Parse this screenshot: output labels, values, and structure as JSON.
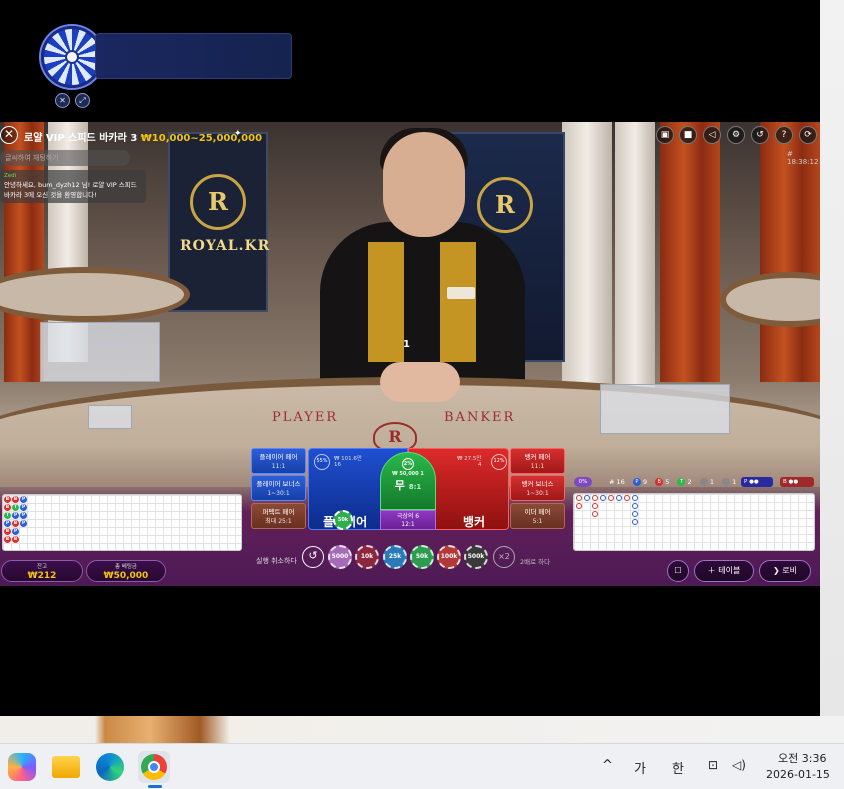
{
  "game": {
    "title": "로얄 VIP 스피드 바카라 3",
    "limits": "₩10,000~25,000,000",
    "clock": "# 18:38:12",
    "dealer_number": "1",
    "chat_placeholder": "글씨하여 채팅하기",
    "chat_user": "Zedi",
    "chat_message": "안녕하세요, bum_dyzh12 님! 로얄 VIP 스피드 바카라 3에 오신 것을 환영합니다!",
    "venue_text": "ROYAL.KR",
    "felt_player": "PLAYER",
    "felt_banker": "BANKER",
    "crest_letter": "R"
  },
  "side_bets": {
    "player_pair": {
      "label": "플레이어 페어",
      "odds": "11:1"
    },
    "player_bonus": {
      "label": "플레이어 보너스",
      "odds": "1~30:1"
    },
    "perfect_pair": {
      "label": "퍼펙트 페어",
      "odds": "최대 25:1"
    },
    "banker_pair": {
      "label": "뱅커 페어",
      "odds": "11:1"
    },
    "banker_bonus": {
      "label": "뱅커 보너스",
      "odds": "1~30:1"
    },
    "either_pair": {
      "label": "이더 페어",
      "odds": "5:1"
    }
  },
  "main_bets": {
    "player_label": "플레이어",
    "player_amount": "₩ 101.6만",
    "player_count": "16",
    "player_pct": "55%",
    "player_chip": "50k",
    "banker_label": "뱅커",
    "banker_amount": "₩ 27.5만",
    "banker_count": "4",
    "banker_pct": "12%",
    "tie_label": "무",
    "tie_odds": "8:1",
    "tie_amount": "₩ 50,000",
    "tie_count": "1",
    "tie_pct": "2%",
    "lucky6_label": "극상의 6",
    "lucky6_odds": "12:1"
  },
  "stats": {
    "pct_badge": "0%",
    "rounds": "# 16",
    "player_wins": "9",
    "banker_wins": "5",
    "ties": "2",
    "player_pairs": "1",
    "banker_pairs": "1",
    "pred_p": "P",
    "pred_b": "B"
  },
  "bead_road": [
    "B",
    "B",
    "T",
    "P",
    "B",
    "B",
    "B",
    "T",
    "P",
    "B",
    "P",
    "B",
    "P",
    "P",
    "P",
    "P"
  ],
  "balance": {
    "label": "잔고",
    "value": "₩212"
  },
  "total_bet": {
    "label": "총 베팅금",
    "value": "₩50,000"
  },
  "controls": {
    "cancel_label": "실행 취소하다",
    "undo_icon": "↺",
    "chips": [
      "5000",
      "10k",
      "25k",
      "50k",
      "100k",
      "500k"
    ],
    "double_icon": "×2",
    "double_label": "2배로 하다",
    "table_label": "테이블",
    "lobby_label": "로비"
  },
  "taskbar": {
    "tray_chevron": "^",
    "ime_1": "가",
    "ime_2": "한",
    "time": "오전 3:36",
    "date": "2026-01-15"
  },
  "colors": {
    "player_blue": "#1f4fd0",
    "banker_red": "#dd2a2a",
    "tie_green": "#2bb84a",
    "bet_panel_purple": "#4d1a55",
    "limits_gold": "#f1c40f"
  }
}
